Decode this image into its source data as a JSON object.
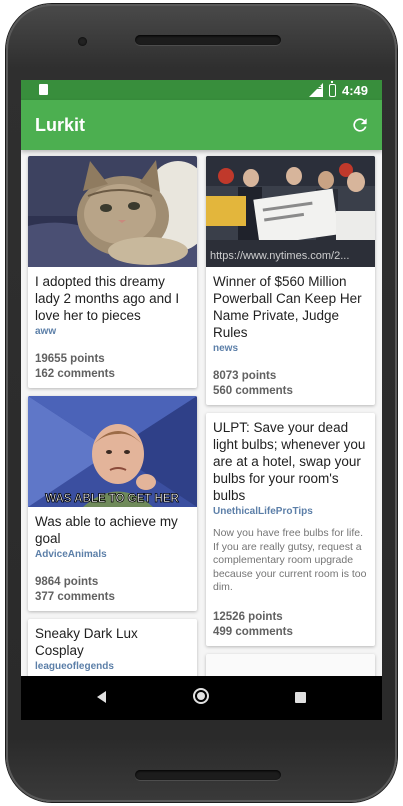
{
  "statusbar": {
    "time": "4:49",
    "network": "LTE"
  },
  "appbar": {
    "title": "Lurkit",
    "refresh_icon": "refresh-icon"
  },
  "feed": {
    "left": [
      {
        "title": "I adopted this dreamy lady 2 months ago and I love her to pieces",
        "subreddit": "aww",
        "points": "19655 points",
        "comments": "162 comments",
        "image": "kitten-photo"
      },
      {
        "title": "Was able to achieve my goal",
        "subreddit": "AdviceAnimals",
        "points": "9864 points",
        "comments": "377 comments",
        "image": "success-kid-meme",
        "meme_caption": "WAS ABLE TO GET HER"
      },
      {
        "title": "Sneaky Dark Lux Cosplay",
        "subreddit": "leagueoflegends"
      }
    ],
    "right": [
      {
        "title": "Winner of $560 Million Powerball Can Keep Her Name Private, Judge Rules",
        "subreddit": "news",
        "points": "8073 points",
        "comments": "560 comments",
        "image": "powerball-check-photo",
        "watermark": "https://www.nytimes.com/2..."
      },
      {
        "title": "ULPT: Save your dead light bulbs; whenever you are at a hotel, swap your bulbs for your room's bulbs",
        "subreddit": "UnethicalLifeProTips",
        "description": "Now you have free bulbs for life. If you are really gutsy, request a complementary room upgrade because your current room is too dim.",
        "points": "12526 points",
        "comments": "499 comments"
      }
    ]
  },
  "colors": {
    "primary": "#4caf50",
    "primary_dark": "#388e3c",
    "subreddit": "#5c7fa8"
  }
}
